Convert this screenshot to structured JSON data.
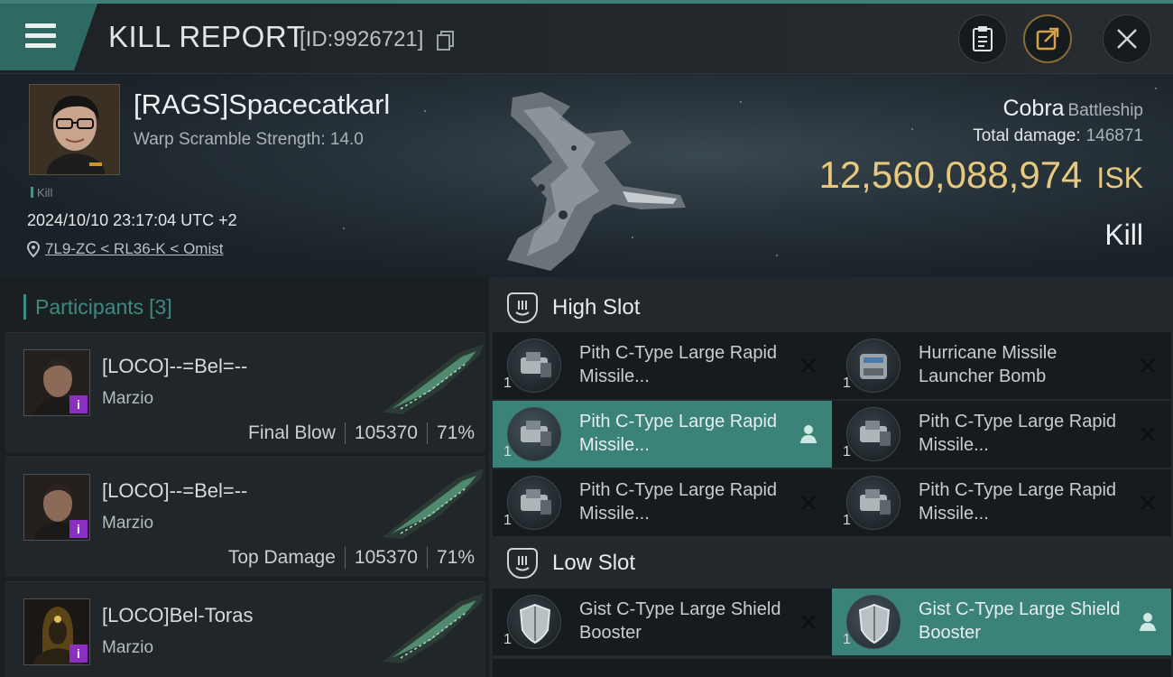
{
  "header": {
    "title": "KILL REPORT",
    "report_id": "[ID:9926721]",
    "icons": [
      "menu-icon",
      "copy-icon",
      "clipboard-icon",
      "share-icon",
      "close-icon"
    ],
    "accent_color": "#2f6a62"
  },
  "victim": {
    "name": "[RAGS]Spacecatkarl",
    "warp_scramble": "Warp Scramble Strength: 14.0",
    "tag": "Kill",
    "datetime": "2024/10/10 23:17:04 UTC +2",
    "location": "7L9-ZC < RL36-K < Omist",
    "ship_name": "Cobra",
    "ship_class": "Battleship",
    "total_damage_label": "Total damage:",
    "total_damage_value": "146871",
    "isk_value": "12,560,088,974",
    "isk_unit": "ISK",
    "kill_type": "Kill",
    "isk_color": "#e7c97e"
  },
  "participants": {
    "heading": "Participants",
    "count": "[3]",
    "items": [
      {
        "name": "[LOCO]--=Bel=--",
        "ship": "Marzio",
        "role": "Final Blow",
        "damage": "105370",
        "percent": "71%",
        "badge": "i"
      },
      {
        "name": "[LOCO]--=Bel=--",
        "ship": "Marzio",
        "role": "Top Damage",
        "damage": "105370",
        "percent": "71%",
        "badge": "i"
      },
      {
        "name": "[LOCO]Bel-Toras",
        "ship": "Marzio",
        "role": "",
        "damage": "",
        "percent": "",
        "badge": "i"
      }
    ]
  },
  "fitting": {
    "high_slot_label": "High Slot",
    "low_slot_label": "Low Slot",
    "high_slot": [
      {
        "name": "Pith C-Type Large Rapid Missile...",
        "qty": "1",
        "status": "destroyed"
      },
      {
        "name": "Hurricane Missile Launcher Bomb",
        "qty": "1",
        "status": "destroyed"
      },
      {
        "name": "Pith C-Type Large Rapid Missile...",
        "qty": "1",
        "status": "dropped"
      },
      {
        "name": "Pith C-Type Large Rapid Missile...",
        "qty": "1",
        "status": "destroyed"
      },
      {
        "name": "Pith C-Type Large Rapid Missile...",
        "qty": "1",
        "status": "destroyed"
      },
      {
        "name": "Pith C-Type Large Rapid Missile...",
        "qty": "1",
        "status": "destroyed"
      }
    ],
    "low_slot": [
      {
        "name": "Gist C-Type Large Shield Booster",
        "qty": "1",
        "status": "destroyed"
      },
      {
        "name": "Gist C-Type Large Shield Booster",
        "qty": "1",
        "status": "dropped"
      }
    ],
    "dropped_color": "#3b8279"
  }
}
